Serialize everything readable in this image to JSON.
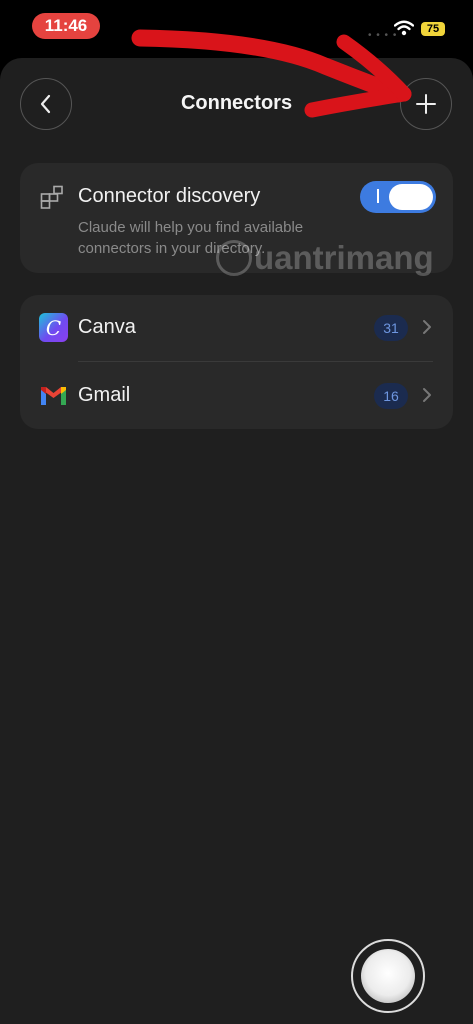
{
  "status_bar": {
    "time": "11:46",
    "battery": "75"
  },
  "header": {
    "title": "Connectors"
  },
  "discovery": {
    "title": "Connector discovery",
    "description": "Claude will help you find available connectors in your directory.",
    "toggle_on": true
  },
  "connectors": [
    {
      "name": "Canva",
      "count": "31",
      "icon": "canva-icon"
    },
    {
      "name": "Gmail",
      "count": "16",
      "icon": "gmail-icon"
    }
  ],
  "watermark": {
    "text": "uantrimang"
  },
  "colors": {
    "background": "#1f1f1f",
    "card": "#292929",
    "accent": "#3d7be0",
    "time_pill": "#e5433f",
    "arrow": "#d9141a"
  }
}
